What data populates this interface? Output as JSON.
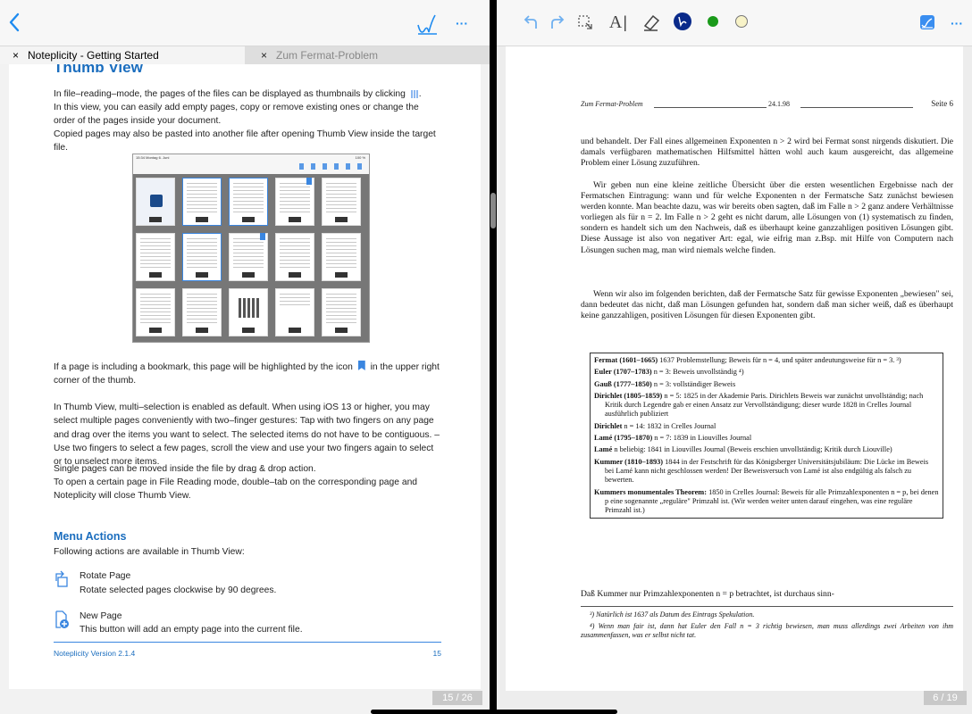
{
  "left": {
    "toolbar": {
      "back_icon": "chevron-left-icon",
      "draw_icon": "signature-icon",
      "more_label": "···"
    },
    "tabs": [
      {
        "close": "×",
        "label": "Noteplicity - Getting Started"
      },
      {
        "close": "×",
        "label": "Zum Fermat-Problem"
      }
    ],
    "page": {
      "title": "Thumb View",
      "p1": "In file–reading–mode, the pages of the files can be displayed as thumbnails by clicking",
      "p2": "In this view, you can easily add empty pages, copy or remove existing ones or change the order of the pages inside your document.",
      "p3": "Copied pages may also be pasted into another file after opening Thumb View inside the target file.",
      "screenshot": {
        "status_left": "15:34 Montag 6. Juni",
        "status_right": "100 %"
      },
      "p4a": "If a page is including a bookmark, this page will be highlighted by the icon",
      "p4b": "in the upper right corner of the thumb.",
      "p5": "In Thumb View, multi–selection is enabled as default. When using iOS 13 or higher, you may select multiple pages conveniently with two–finger gestures: Tap with two fingers on any page and drag over the items you want to select. The selected items do not have to be contiguous. – Use two fingers to select a few pages, scroll the view and use your two fingers again to select or to unselect more items.",
      "p6": "Single pages can be moved inside the file by drag & drop action.",
      "p7": "To open a certain page in File Reading mode, double–tab on the corresponding page and Noteplicity will close Thumb View.",
      "menu_title": "Menu Actions",
      "menu_intro": "Following actions are available in Thumb View:",
      "actions": [
        {
          "icon": "rotate-page-icon",
          "title": "Rotate Page",
          "desc": "Rotate selected pages clockwise by 90 degrees."
        },
        {
          "icon": "new-page-icon",
          "title": "New Page",
          "desc": "This button will add an empty page into the current file."
        }
      ],
      "footer_left": "Noteplicity  Version 2.1.4",
      "footer_right": "15"
    },
    "page_indicator": "15 / 26"
  },
  "right": {
    "toolbar": {
      "undo_icon": "undo-icon",
      "redo_icon": "redo-icon",
      "lasso_icon": "lasso-select-icon",
      "text_icon": "text-tool-icon",
      "eraser_icon": "eraser-icon",
      "pen_color": "#0a2a8a",
      "green_color": "#1a9a1a",
      "yellow_color": "#f5f0c0",
      "more_label": "···"
    },
    "page": {
      "header_left": "Zum Fermat-Problem",
      "header_mid": "24.1.98",
      "header_right": "Seite 6",
      "para1": "und behandelt. Der Fall eines allgemeinen Exponenten n > 2 wird bei Fermat sonst nirgends diskutiert. Die damals verfügbaren mathematischen Hilfsmittel hätten wohl auch kaum ausgereicht, das allgemeine Problem einer Lösung zuzuführen.",
      "para2": "Wir geben nun eine kleine zeitliche Übersicht über die ersten wesentlichen Ergebnisse nach der Fermatschen Eintragung: wann und für welche Exponenten n der Fermatsche Satz zunächst bewiesen werden konnte. Man beachte dazu, was wir bereits oben sagten, daß im Falle n > 2 ganz andere Verhältnisse vorliegen als für n = 2. Im Falle n > 2 geht es nicht darum, alle Lösungen von (1) systematisch zu finden, sondern es handelt sich um den Nachweis, daß es überhaupt keine ganzzahligen positiven Lösungen gibt. Diese Aussage ist also von negativer Art: egal, wie eifrig man z.Bsp. mit Hilfe von Computern nach Lösungen suchen mag, man wird niemals welche finden.",
      "para3": "Wenn wir also im folgenden berichten, daß der Fermatsche Satz für gewisse Exponenten „bewiesen\" sei, dann bedeutet das nicht, daß man Lösungen gefunden hat, sondern daß man sicher weiß, daß es überhaupt keine ganzzahligen, positiven Lösungen für diesen Exponenten gibt.",
      "entries": [
        {
          "name": "Fermat (1601–1665)",
          "text": "1637 Problemstellung; Beweis für n = 4, und später andeutungsweise für n = 3. ³)"
        },
        {
          "name": "Euler (1707–1783)",
          "text": "n = 3: Beweis unvollständig ⁴)"
        },
        {
          "name": "Gauß (1777–1850)",
          "text": "n = 3: vollständiger Beweis"
        },
        {
          "name": "Dirichlet (1805–1859)",
          "text": "n = 5: 1825 in der Akademie Paris. Dirichlets Beweis war zunächst unvollständig; nach Kritik durch Legendre gab er einen Ansatz zur Vervollständigung; dieser wurde 1828 in Crelles Journal ausführlich publiziert"
        },
        {
          "name": "Dirichlet",
          "text": "n = 14: 1832 in Crelles Journal"
        },
        {
          "name": "Lamé (1795–1870)",
          "text": "n = 7: 1839 in Liouvilles Journal"
        },
        {
          "name": "Lamé",
          "text": "n beliebig: 1841 in Liouvilles Journal (Beweis erschien unvollständig; Kritik durch Liouville)"
        },
        {
          "name": "Kummer (1810–1893)",
          "text": "1844 in der Festschrift für das Königsberger Universitätsjubiläum: Die Lücke im Beweis bei Lamé kann nicht geschlossen werden! Der Beweisversuch von Lamé ist also endgültig als falsch zu bewerten."
        },
        {
          "name": "Kummers monumentales Theorem:",
          "text": "1850 in Crelles Journal: Beweis für alle Primzahlexponenten n = p, bei denen p eine sogenannte „reguläre\" Primzahl ist. (Wir werden weiter unten darauf eingehen, was eine reguläre Primzahl ist.)"
        }
      ],
      "para4": "Daß Kummer nur Primzahlexponenten n = p betrachtet, ist durchaus sinn-",
      "fn3": "³) Natürlich ist 1637 als Datum des Eintrags Spekulation.",
      "fn4": "⁴) Wenn man fair ist, dann hat Euler den Fall n = 3 richtig bewiesen, man muss allerdings zwei Arbeiten von ihm zusammenfassen, was er selbst nicht tat."
    },
    "page_indicator": "6 / 19"
  }
}
